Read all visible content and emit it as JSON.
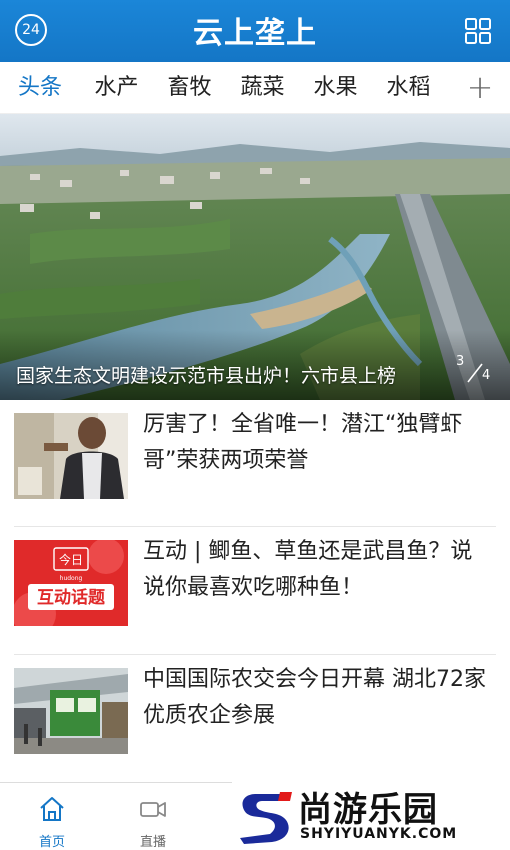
{
  "header": {
    "badge": "24",
    "title": "云上垄上",
    "grid_icon": "grid-icon"
  },
  "tabs": [
    {
      "label": "头条",
      "active": true
    },
    {
      "label": "水产"
    },
    {
      "label": "畜牧"
    },
    {
      "label": "蔬菜"
    },
    {
      "label": "水果"
    },
    {
      "label": "水稻"
    }
  ],
  "tab_add": "+",
  "banner": {
    "caption": "国家生态文明建设示范市县出炉！六市县上榜",
    "page_current": "3",
    "page_total": "4"
  },
  "news": [
    {
      "title": "厉害了！全省唯一！潜江“独臂虾哥”荣获两项荣誉"
    },
    {
      "title": "互动 | 鲫鱼、草鱼还是武昌鱼？说说你最喜欢吃哪种鱼！",
      "thumb_text_top": "今日",
      "thumb_text_main": "互动话题",
      "thumb_text_small": "hudong"
    },
    {
      "title": "中国国际农交会今日开幕 湖北72家优质农企参展"
    }
  ],
  "bottom_nav": {
    "home_label": "首页",
    "live_label": "直播"
  },
  "watermark": {
    "name": "尚游乐园",
    "domain": "SHYIYUANYK.COM"
  },
  "colors": {
    "brand_blue": "#1476c6",
    "thumb_red": "#e02a2a"
  }
}
